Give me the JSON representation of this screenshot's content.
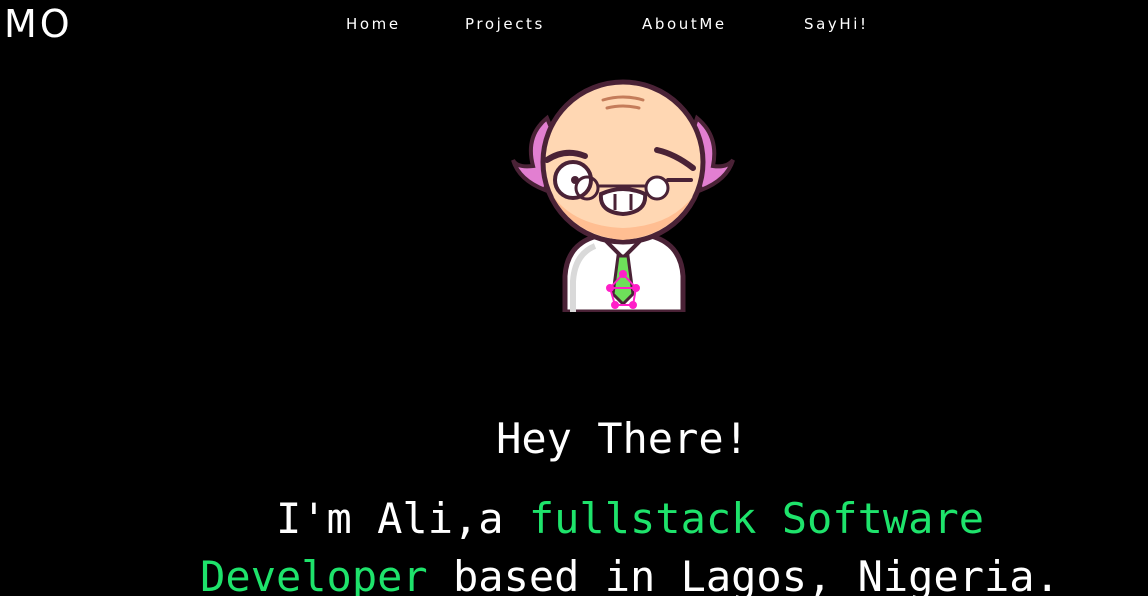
{
  "header": {
    "logo": "MO",
    "nav": [
      {
        "label": "Home"
      },
      {
        "label": "Projects"
      },
      {
        "label": "AboutMe"
      },
      {
        "label": "SayHi!"
      }
    ]
  },
  "hero": {
    "avatar_icon": "cartoon-professor-avatar",
    "greeting": "Hey There!",
    "intro_prefix": "I'm Ali,a",
    "intro_highlight": "fullstack Software Developer",
    "intro_suffix": "based in Lagos, Nigeria."
  },
  "colors": {
    "background": "#000000",
    "text": "#ffffff",
    "accent": "#1ee36b"
  }
}
